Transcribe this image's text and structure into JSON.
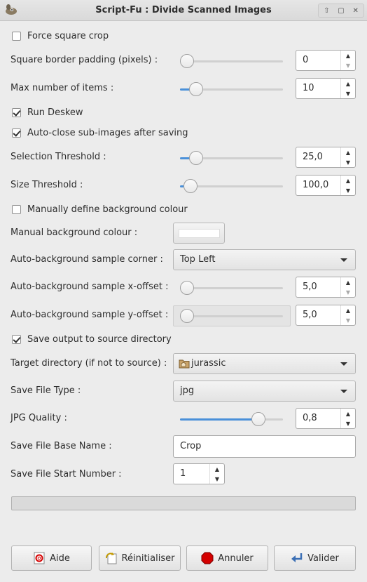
{
  "window": {
    "title": "Script-Fu : Divide Scanned Images"
  },
  "fields": {
    "force_square_crop": {
      "label": "Force square crop",
      "checked": false
    },
    "square_border_padding": {
      "label": "Square border padding (pixels) :",
      "value": "0",
      "fraction": 0.0
    },
    "max_items": {
      "label": "Max number of items :",
      "value": "10",
      "fraction": 0.1
    },
    "run_deskew": {
      "label": "Run Deskew",
      "checked": true
    },
    "auto_close": {
      "label": "Auto-close sub-images after saving",
      "checked": true
    },
    "selection_threshold": {
      "label": "Selection Threshold :",
      "value": "25,0",
      "fraction": 0.1
    },
    "size_threshold": {
      "label": "Size Threshold :",
      "value": "100,0",
      "fraction": 0.04
    },
    "manual_bg": {
      "label": "Manually define background colour",
      "checked": false
    },
    "manual_bg_colour": {
      "label": "Manual background colour :",
      "color": "#ffffff"
    },
    "sample_corner": {
      "label": "Auto-background sample corner :",
      "value": "Top Left"
    },
    "sample_x_offset": {
      "label": "Auto-background sample x-offset :",
      "value": "5,0",
      "fraction": 0.0
    },
    "sample_y_offset": {
      "label": "Auto-background sample y-offset :",
      "value": "5,0",
      "fraction": 0.0
    },
    "save_to_source": {
      "label": "Save output to source directory",
      "checked": true
    },
    "target_dir": {
      "label": "Target directory (if not to source) :",
      "value": "jurassic",
      "icon": "folder-icon"
    },
    "file_type": {
      "label": "Save File Type :",
      "value": "jpg"
    },
    "jpg_quality": {
      "label": "JPG Quality :",
      "value": "0,8",
      "fraction": 0.8
    },
    "base_name": {
      "label": "Save File Base Name :",
      "value": "Crop"
    },
    "start_number": {
      "label": "Save File Start Number :",
      "value": "1"
    }
  },
  "buttons": {
    "help": "Aide",
    "reset": "Réinitialiser",
    "cancel": "Annuler",
    "ok": "Valider"
  },
  "colors": {
    "accent": "#4a90d9",
    "cancel_icon": "#d40000"
  }
}
